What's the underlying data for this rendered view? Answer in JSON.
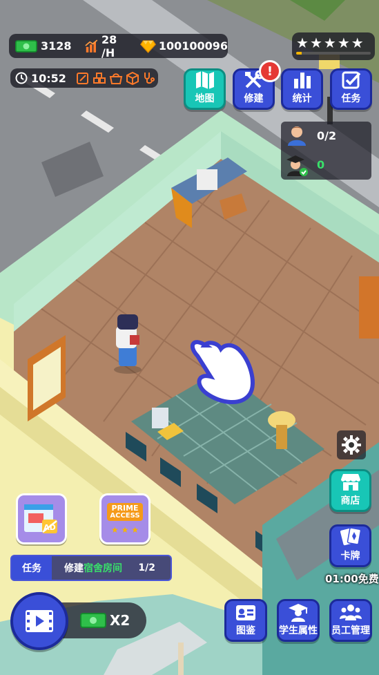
{
  "resources": {
    "cash": "3128",
    "rate": "28 /H",
    "gems": "100100096"
  },
  "clock": {
    "time": "10:52"
  },
  "stars": {
    "count": 5,
    "progress": 0.07
  },
  "top_buttons": [
    {
      "label": "地图",
      "icon": "map-icon"
    },
    {
      "label": "修建",
      "icon": "build-tools-icon",
      "alert": "!"
    },
    {
      "label": "统计",
      "icon": "bar-chart-icon"
    },
    {
      "label": "任务",
      "icon": "checklist-icon"
    }
  ],
  "staff_panel": {
    "workers": "0/2",
    "graduates": "0"
  },
  "side_buttons": {
    "shop": "商店",
    "cards": "卡牌",
    "free_timer": "01:00免费"
  },
  "promo": {
    "prime_line1": "PRIME",
    "prime_line2": "ACCESS"
  },
  "task_bar": {
    "tag": "任务",
    "text_prefix": "修建",
    "text_highlight": "宿舍房间",
    "progress": "1/2"
  },
  "video_bonus": {
    "multiplier": "X2"
  },
  "bottom_buttons": [
    {
      "label": "图鉴",
      "icon": "id-card-icon"
    },
    {
      "label": "学生属性",
      "icon": "graduate-cap-icon"
    },
    {
      "label": "员工管理",
      "icon": "staff-group-icon"
    }
  ],
  "colors": {
    "accent_blue": "#3a4fd8",
    "teal": "#18c6b6",
    "highlight_green": "#39e06a",
    "gold": "#f5b400"
  }
}
